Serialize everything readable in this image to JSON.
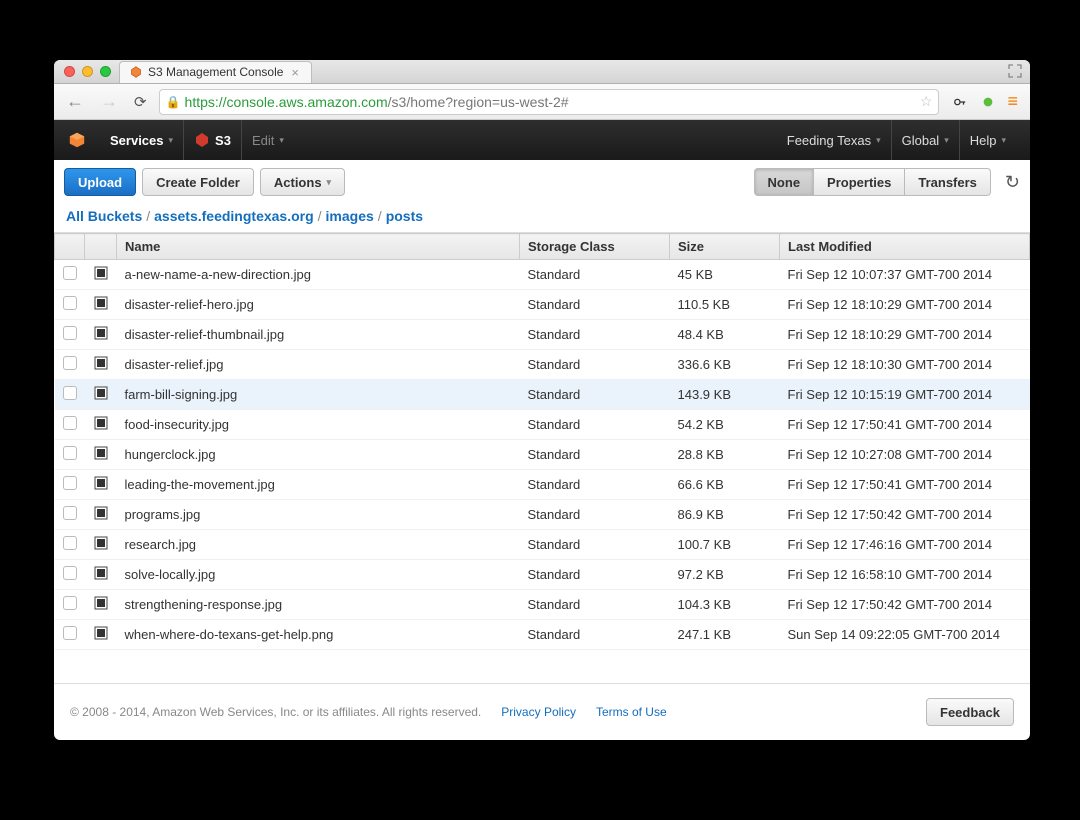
{
  "browser": {
    "tab_title": "S3 Management Console",
    "url_scheme": "https",
    "url_host": "://console.aws.amazon.com",
    "url_path": "/s3/home?region=us-west-2#"
  },
  "awsbar": {
    "services": "Services",
    "s3": "S3",
    "edit": "Edit",
    "account": "Feeding Texas",
    "region": "Global",
    "help": "Help"
  },
  "toolbar": {
    "upload": "Upload",
    "create_folder": "Create Folder",
    "actions": "Actions",
    "none": "None",
    "properties": "Properties",
    "transfers": "Transfers"
  },
  "breadcrumbs": [
    "All Buckets",
    "assets.feedingtexas.org",
    "images",
    "posts"
  ],
  "columns": {
    "name": "Name",
    "storage": "Storage Class",
    "size": "Size",
    "modified": "Last Modified"
  },
  "files": [
    {
      "name": "a-new-name-a-new-direction.jpg",
      "storage": "Standard",
      "size": "45 KB",
      "modified": "Fri Sep 12 10:07:37 GMT-700 2014"
    },
    {
      "name": "disaster-relief-hero.jpg",
      "storage": "Standard",
      "size": "110.5 KB",
      "modified": "Fri Sep 12 18:10:29 GMT-700 2014"
    },
    {
      "name": "disaster-relief-thumbnail.jpg",
      "storage": "Standard",
      "size": "48.4 KB",
      "modified": "Fri Sep 12 18:10:29 GMT-700 2014"
    },
    {
      "name": "disaster-relief.jpg",
      "storage": "Standard",
      "size": "336.6 KB",
      "modified": "Fri Sep 12 18:10:30 GMT-700 2014"
    },
    {
      "name": "farm-bill-signing.jpg",
      "storage": "Standard",
      "size": "143.9 KB",
      "modified": "Fri Sep 12 10:15:19 GMT-700 2014",
      "hover": true
    },
    {
      "name": "food-insecurity.jpg",
      "storage": "Standard",
      "size": "54.2 KB",
      "modified": "Fri Sep 12 17:50:41 GMT-700 2014"
    },
    {
      "name": "hungerclock.jpg",
      "storage": "Standard",
      "size": "28.8 KB",
      "modified": "Fri Sep 12 10:27:08 GMT-700 2014"
    },
    {
      "name": "leading-the-movement.jpg",
      "storage": "Standard",
      "size": "66.6 KB",
      "modified": "Fri Sep 12 17:50:41 GMT-700 2014"
    },
    {
      "name": "programs.jpg",
      "storage": "Standard",
      "size": "86.9 KB",
      "modified": "Fri Sep 12 17:50:42 GMT-700 2014"
    },
    {
      "name": "research.jpg",
      "storage": "Standard",
      "size": "100.7 KB",
      "modified": "Fri Sep 12 17:46:16 GMT-700 2014"
    },
    {
      "name": "solve-locally.jpg",
      "storage": "Standard",
      "size": "97.2 KB",
      "modified": "Fri Sep 12 16:58:10 GMT-700 2014"
    },
    {
      "name": "strengthening-response.jpg",
      "storage": "Standard",
      "size": "104.3 KB",
      "modified": "Fri Sep 12 17:50:42 GMT-700 2014"
    },
    {
      "name": "when-where-do-texans-get-help.png",
      "storage": "Standard",
      "size": "247.1 KB",
      "modified": "Sun Sep 14 09:22:05 GMT-700 2014"
    }
  ],
  "footer": {
    "copyright": "© 2008 - 2014, Amazon Web Services, Inc. or its affiliates. All rights reserved.",
    "privacy": "Privacy Policy",
    "terms": "Terms of Use",
    "feedback": "Feedback"
  }
}
